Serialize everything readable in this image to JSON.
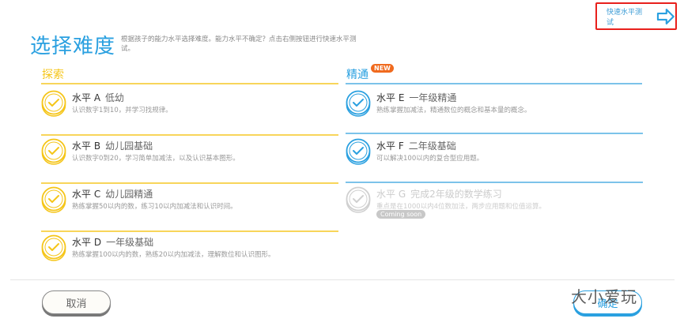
{
  "header": {
    "title": "选择难度",
    "subtitle": "根据孩子的能力水平选择难度。能力水平不确定？点击右侧按钮进行快速水平测试。",
    "quick_test_label": "快速水平测试"
  },
  "explore": {
    "label": "探索",
    "color": "#f5c518",
    "items": [
      {
        "level": "水平 A",
        "name": "低幼",
        "desc": "认识数字1到10，并学习找规律。"
      },
      {
        "level": "水平 B",
        "name": "幼儿园基础",
        "desc": "认识数字0到20，学习简单加减法，以及认识基本图形。"
      },
      {
        "level": "水平 C",
        "name": "幼儿园精通",
        "desc": "熟练掌握50以内的数，练习10以内加减法和认识时间。"
      },
      {
        "level": "水平 D",
        "name": "一年级基础",
        "desc": "熟练掌握100以内的数，熟练20以内加减法，理解数位和认识图形。"
      }
    ]
  },
  "mastery": {
    "label": "精通",
    "badge": "NEW",
    "color": "#2aa0e0",
    "items": [
      {
        "level": "水平 E",
        "name": "一年级精通",
        "desc": "熟练掌握加减法，精通数位的概念和基本量的概念。"
      },
      {
        "level": "水平 F",
        "name": "二年级基础",
        "desc": "可以解决100以内的复合型应用题。"
      },
      {
        "level": "水平 G",
        "name": "完成2年级的数学练习",
        "desc": "重点是在1000以内4位数加法，两步应用题和位值运算。",
        "status": "Coming soon"
      }
    ]
  },
  "footer": {
    "cancel": "取消",
    "confirm": "确定"
  },
  "watermark": "大小爱玩"
}
